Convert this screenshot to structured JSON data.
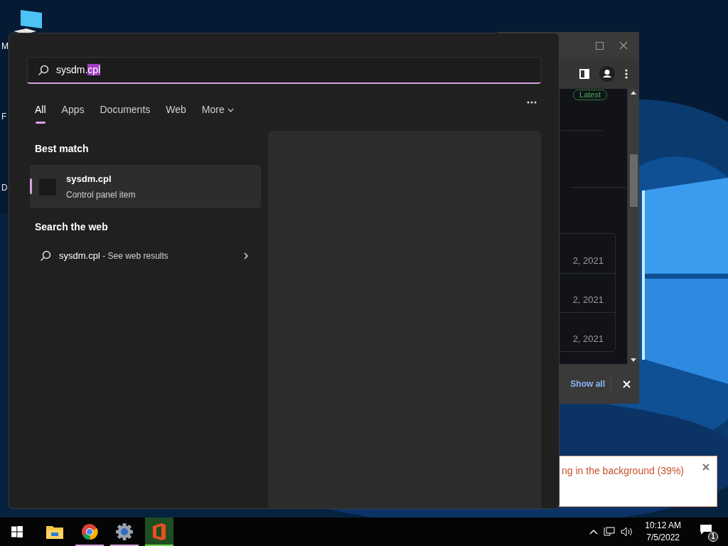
{
  "desktop": {
    "icons": [
      {
        "label": "M",
        "kind": "computer"
      },
      {
        "label": "F",
        "kind": "hidden"
      },
      {
        "label": "D",
        "kind": "hidden"
      }
    ]
  },
  "browser_window": {
    "badge": "Latest",
    "dates": [
      "2, 2021",
      "2, 2021",
      "2, 2021"
    ],
    "show_all": "Show all"
  },
  "notification": {
    "text": "ng in the background (39%)"
  },
  "search_panel": {
    "search": {
      "text": "sysdm.",
      "selection": "cpl"
    },
    "tabs": [
      {
        "label": "All",
        "selected": true,
        "dropdown": false
      },
      {
        "label": "Apps",
        "selected": false,
        "dropdown": false
      },
      {
        "label": "Documents",
        "selected": false,
        "dropdown": false
      },
      {
        "label": "Web",
        "selected": false,
        "dropdown": false
      },
      {
        "label": "More",
        "selected": false,
        "dropdown": true
      }
    ],
    "best_match": {
      "heading": "Best match",
      "items": [
        {
          "title": "sysdm.cpl",
          "subtitle": "Control panel item",
          "selected": true
        }
      ]
    },
    "web": {
      "heading": "Search the web",
      "items": [
        {
          "query": "sysdm.cpl",
          "hint": " - See web results"
        }
      ]
    }
  },
  "taskbar": {
    "apps": [
      {
        "kind": "folder",
        "running": false,
        "active": false
      },
      {
        "kind": "chrome",
        "running": true,
        "active": false
      },
      {
        "kind": "settings",
        "running": true,
        "active": false
      },
      {
        "kind": "office",
        "running": true,
        "active": true
      }
    ],
    "time": "10:12 AM",
    "date": "7/5/2022",
    "notification_count": "1"
  }
}
